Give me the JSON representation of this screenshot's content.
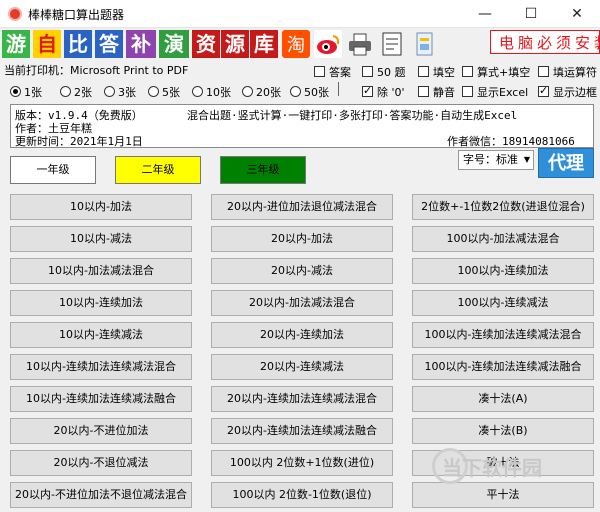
{
  "window": {
    "title": "棒棒糖口算出题器",
    "min": "—",
    "max": "☐",
    "close": "✕"
  },
  "toolbar": {
    "tiles": [
      {
        "char": "游",
        "bg": "#3ab54a",
        "fg": "#ffffff"
      },
      {
        "char": "自",
        "bg": "#ffd200",
        "fg": "#e4171b"
      },
      {
        "char": "比",
        "bg": "#2b63c4",
        "fg": "#ffffff"
      },
      {
        "char": "答",
        "bg": "#2b63c4",
        "fg": "#ffffff"
      },
      {
        "char": "补",
        "bg": "#8e44ad",
        "fg": "#ffffff"
      },
      {
        "char": "演",
        "bg": "#2e9e3f",
        "fg": "#ffffff"
      },
      {
        "char": "资",
        "bg": "#c41a1a",
        "fg": "#ffffff"
      },
      {
        "char": "源",
        "bg": "#c41a1a",
        "fg": "#ffffff"
      },
      {
        "char": "库",
        "bg": "#c41a1a",
        "fg": "#ffffff"
      }
    ],
    "ad_text": "电脑必须安装"
  },
  "printer": {
    "label": "当前打印机：Microsoft Print to PDF"
  },
  "options": {
    "answers": "答案",
    "fifty": "50 题",
    "fill_blank": "填空",
    "formula_fill": "算式+填空",
    "fill_operator": "填运算符",
    "div_zero": "除 '0'",
    "mute": "静音",
    "show_excel": "显示Excel",
    "show_border": "显示边框"
  },
  "sheets": [
    "1张",
    "2张",
    "3张",
    "5张",
    "10张",
    "20张",
    "50张"
  ],
  "info": {
    "version": "版本：v1.9.4（免费版）",
    "features": "混合出题·竖式计算·一键打印·多张打印·答案功能·自动生成Excel",
    "author": "作者：土豆年糕",
    "wechat": "作者微信：18914081066",
    "updated": "更新时间：2021年1月1日"
  },
  "grades": [
    {
      "label": "一年级",
      "bg": "#ffffff",
      "fg": "#000000"
    },
    {
      "label": "二年级",
      "bg": "#ffff00",
      "fg": "#000000"
    },
    {
      "label": "三年级",
      "bg": "#008000",
      "fg": "#000000"
    }
  ],
  "font_size": {
    "label": "字号：标准"
  },
  "agent_label": "代理",
  "columns": [
    [
      "10以内-加法",
      "10以内-减法",
      "10以内-加法减法混合",
      "10以内-连续加法",
      "10以内-连续减法",
      "10以内-连续加法连续减法混合",
      "10以内-连续加法连续减法融合",
      "20以内-不进位加法",
      "20以内-不退位减法",
      "20以内-不进位加法不退位减法混合"
    ],
    [
      "20以内-进位加法退位减法混合",
      "20以内-加法",
      "20以内-减法",
      "20以内-加法减法混合",
      "20以内-连续加法",
      "20以内-连续减法",
      "20以内-连续加法连续减法混合",
      "20以内-连续加法连续减法融合",
      "100以内 2位数+1位数(进位)",
      "100以内 2位数-1位数(退位)"
    ],
    [
      "2位数+-1位数2位数(进退位混合)",
      "100以内-加法减法混合",
      "100以内-连续加法",
      "100以内-连续减法",
      "100以内-连续加法连续减法混合",
      "100以内-连续加法连续减法融合",
      "凑十法(A)",
      "凑十法(B)",
      "破十法",
      "平十法"
    ]
  ],
  "watermark": "当下软件园"
}
